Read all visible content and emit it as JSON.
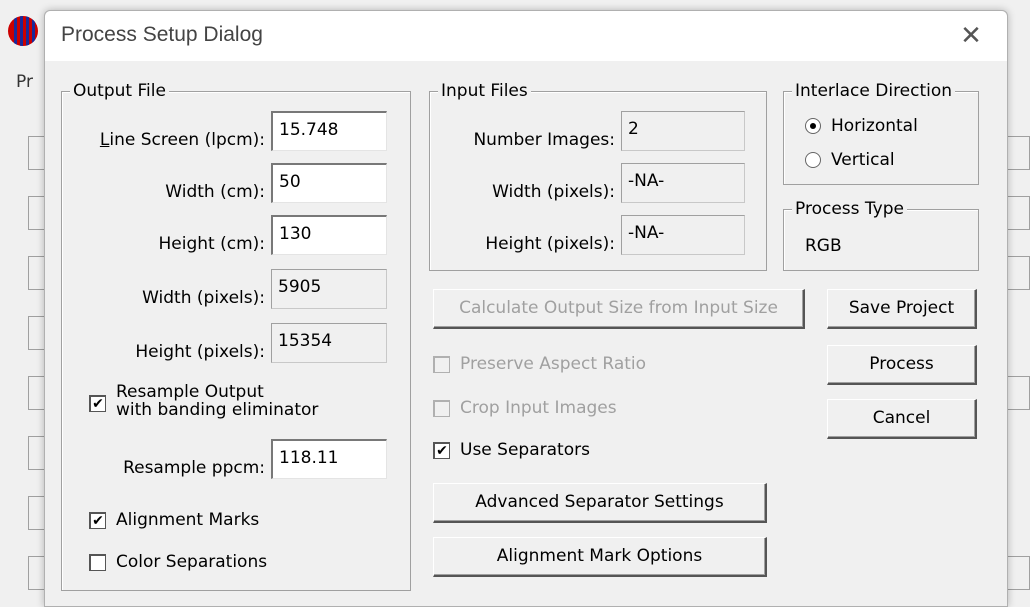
{
  "window": {
    "title": "Process Setup Dialog",
    "close_glyph": "✕"
  },
  "background": {
    "menu_fragment": "Pr",
    "app_icon": "app-icon"
  },
  "output_file": {
    "legend": "Output File",
    "line_screen": {
      "label": "Line Screen (lpcm):",
      "value": "15.748"
    },
    "width_cm": {
      "label": "Width (cm):",
      "value": "50"
    },
    "height_cm": {
      "label": "Height (cm):",
      "value": "130"
    },
    "width_px": {
      "label": "Width (pixels):",
      "value": "5905"
    },
    "height_px": {
      "label": "Height (pixels):",
      "value": "15354"
    },
    "resample_output": {
      "line1": "Resample Output",
      "line2": "with banding eliminator",
      "checked": true
    },
    "resample_ppcm": {
      "label": "Resample ppcm:",
      "value": "118.11"
    },
    "alignment_marks": {
      "label": "Alignment Marks",
      "checked": true
    },
    "color_separations": {
      "label": "Color Separations",
      "checked": false
    }
  },
  "input_files": {
    "legend": "Input Files",
    "number_images": {
      "label": "Number Images:",
      "value": "2"
    },
    "width_px": {
      "label": "Width (pixels):",
      "value": "-NA-"
    },
    "height_px": {
      "label": "Height (pixels):",
      "value": "-NA-"
    }
  },
  "interlace_direction": {
    "legend": "Interlace Direction",
    "options": [
      {
        "label": "Horizontal",
        "selected": true
      },
      {
        "label": "Vertical",
        "selected": false
      }
    ]
  },
  "process_type": {
    "legend": "Process Type",
    "value": "RGB"
  },
  "actions": {
    "calculate": "Calculate Output Size from Input Size",
    "save_project": "Save Project",
    "process": "Process",
    "cancel": "Cancel",
    "advanced_separator": "Advanced Separator Settings",
    "alignment_mark_options": "Alignment Mark Options"
  },
  "options": {
    "preserve_aspect": {
      "label": "Preserve Aspect Ratio",
      "checked": false,
      "enabled": false
    },
    "crop_input": {
      "label": "Crop Input Images",
      "checked": false,
      "enabled": false
    },
    "use_separators": {
      "label": "Use Separators",
      "checked": true,
      "enabled": true
    }
  },
  "colors": {
    "check_glyph": "✔"
  }
}
